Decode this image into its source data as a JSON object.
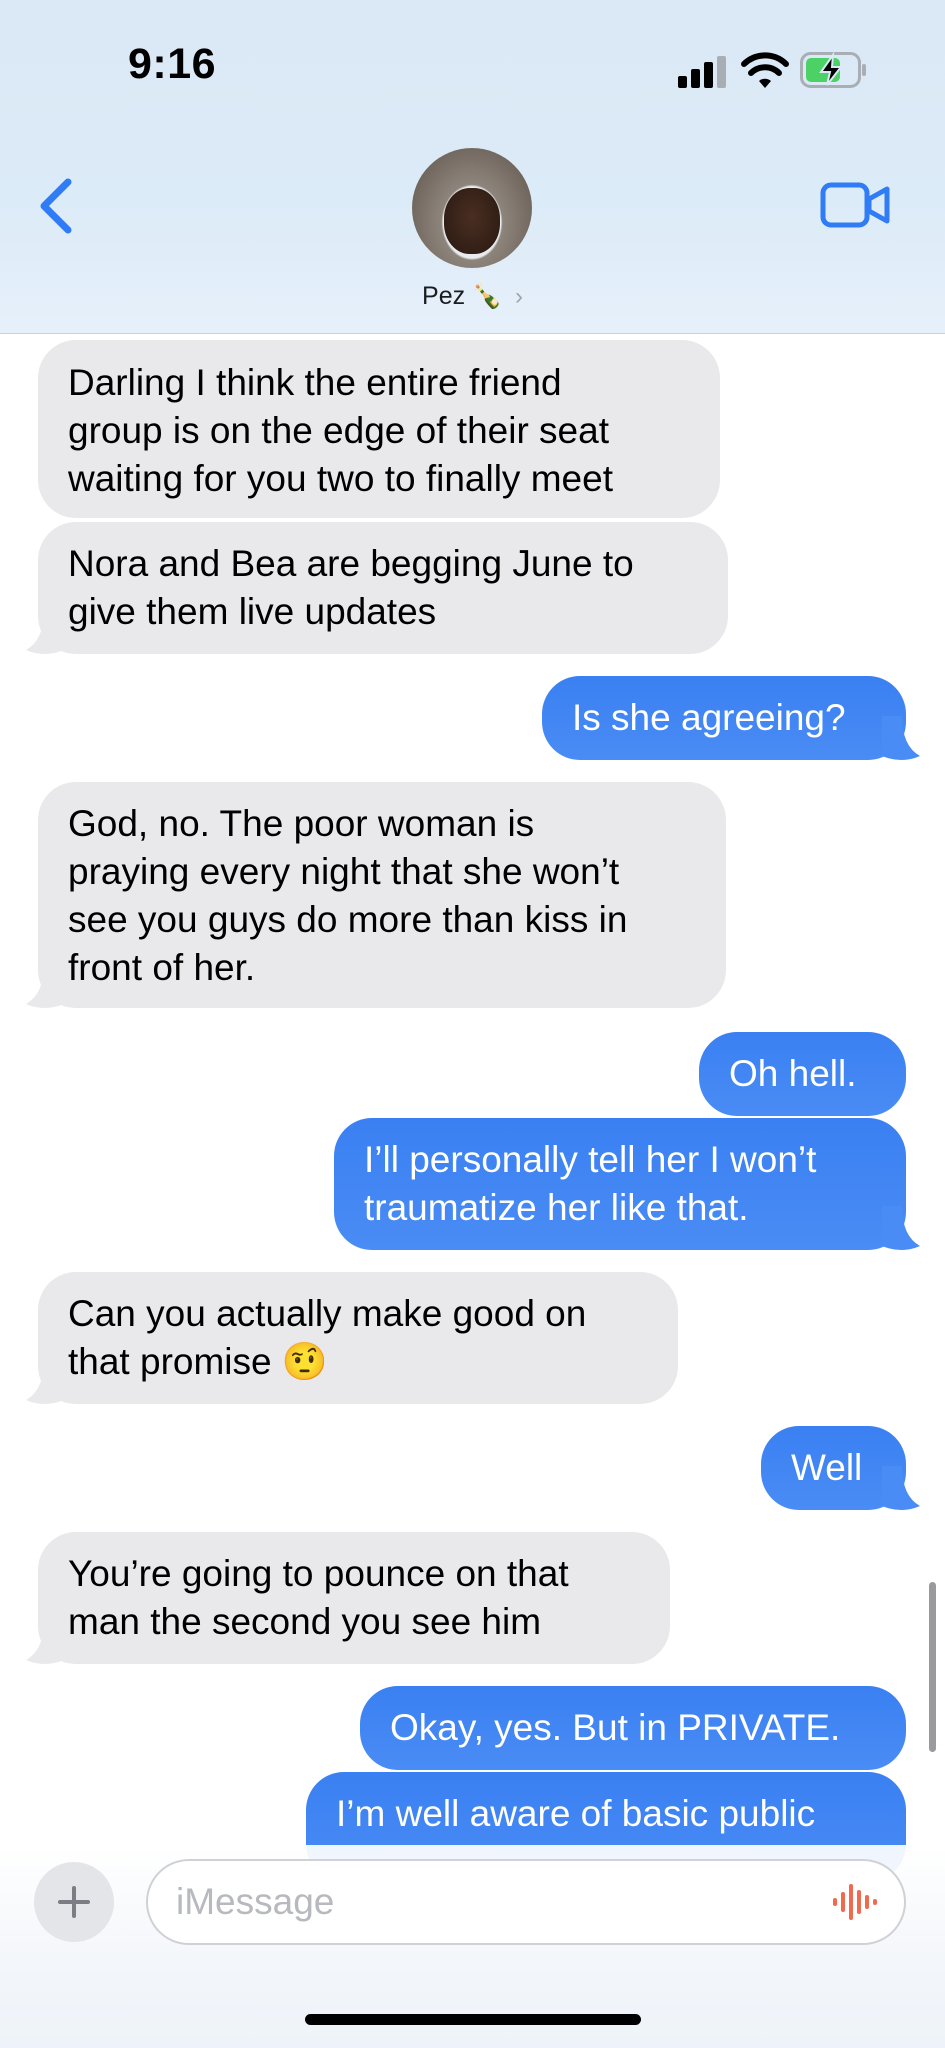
{
  "status_bar": {
    "time": "9:16"
  },
  "header": {
    "contact_name": "Pez",
    "contact_emoji": "🍾",
    "chevron": "›"
  },
  "icons": {
    "back": "chevron-left-icon",
    "video": "video-camera-icon",
    "signal": "cellular-signal-icon",
    "wifi": "wifi-icon",
    "battery": "battery-charging-icon",
    "add": "plus-icon",
    "audio": "waveform-icon"
  },
  "colors": {
    "outgoing": "#3b82f6",
    "incoming": "#e9e9eb",
    "accent": "#2f7cf6",
    "audio_icon": "#ef6a4e"
  },
  "messages": [
    {
      "dir": "in",
      "lines": [
        "Darling I think the entire friend",
        "group is on the edge of their seat",
        "waiting for you two to finally meet"
      ]
    },
    {
      "dir": "in",
      "lines": [
        "Nora and Bea are begging June to",
        "give them live updates"
      ]
    },
    {
      "dir": "out",
      "lines": [
        "Is she agreeing?"
      ]
    },
    {
      "dir": "in",
      "lines": [
        "God, no. The poor woman is",
        "praying every night that she won’t",
        "see you guys do more than kiss in",
        "front of her."
      ]
    },
    {
      "dir": "out",
      "lines": [
        "Oh hell."
      ]
    },
    {
      "dir": "out",
      "lines": [
        "I’ll personally tell her I won’t",
        "traumatize her like that."
      ]
    },
    {
      "dir": "in",
      "lines": [
        "Can you actually make good on",
        "that promise 🤨"
      ]
    },
    {
      "dir": "out",
      "lines": [
        "Well"
      ]
    },
    {
      "dir": "in",
      "lines": [
        "You’re going to pounce on that",
        "man the second you see him"
      ]
    },
    {
      "dir": "out",
      "lines": [
        "Okay, yes. But in PRIVATE."
      ]
    },
    {
      "dir": "out",
      "lines": [
        "I’m well aware of basic public"
      ]
    }
  ],
  "composer": {
    "placeholder": "iMessage"
  }
}
